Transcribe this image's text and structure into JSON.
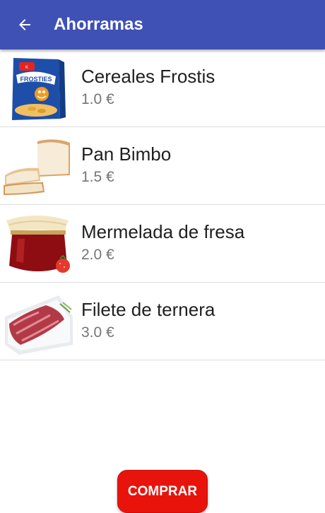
{
  "appbar": {
    "title": "Ahorramas",
    "back_icon": "arrow-back-icon",
    "color": "#3f51b5"
  },
  "products": [
    {
      "name": "Cereales Frostis",
      "price": "1.0 €",
      "image": "cereal-box-image"
    },
    {
      "name": "Pan Bimbo",
      "price": "1.5 €",
      "image": "bread-image"
    },
    {
      "name": "Mermelada de fresa",
      "price": "2.0 €",
      "image": "jam-jar-image"
    },
    {
      "name": "Filete de ternera",
      "price": "3.0 €",
      "image": "beef-fillet-image"
    }
  ],
  "actions": {
    "buy_label": "COMPRAR",
    "buy_color": "#e8140c"
  }
}
